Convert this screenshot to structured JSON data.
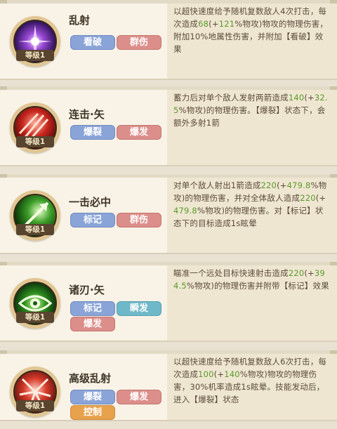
{
  "level_label": "等级1",
  "skills": [
    {
      "name": "乱射",
      "tags": [
        "看破",
        "群伤"
      ],
      "desc": [
        {
          "t": "以超快速度给予随机复数敌人4次打击，每次造成"
        },
        {
          "t": "68",
          "hl": true
        },
        {
          "t": "(+"
        },
        {
          "t": "121",
          "hl": true
        },
        {
          "t": "%物攻)物攻的物理伤害，附加10%地属性伤害，并附加【看破】效果"
        }
      ]
    },
    {
      "name": "连击·矢",
      "tags": [
        "爆裂",
        "爆发"
      ],
      "desc": [
        {
          "t": "蓄力后对单个敌人发射两箭造成"
        },
        {
          "t": "140",
          "hl": true
        },
        {
          "t": "(+"
        },
        {
          "t": "32.5",
          "hl": true
        },
        {
          "t": "%物攻)的物理伤害。【爆裂】状态下，会额外多射1箭"
        }
      ]
    },
    {
      "name": "一击必中",
      "tags": [
        "标记",
        "群伤"
      ],
      "desc": [
        {
          "t": "对单个敌人射出1箭造成"
        },
        {
          "t": "220",
          "hl": true
        },
        {
          "t": "(+"
        },
        {
          "t": "479.8",
          "hl": true
        },
        {
          "t": "%物攻)的物理伤害，并对全体敌人造成"
        },
        {
          "t": "220",
          "hl": true
        },
        {
          "t": "(+"
        },
        {
          "t": "479.8",
          "hl": true
        },
        {
          "t": "%物攻)的物理伤害。对【标记】状态下的目标造成1s眩晕"
        }
      ]
    },
    {
      "name": "诸刃·矢",
      "tags": [
        "标记",
        "瞬发",
        "爆发"
      ],
      "desc": [
        {
          "t": "瞄准一个远处目标快速射击造成"
        },
        {
          "t": "220",
          "hl": true
        },
        {
          "t": "(+"
        },
        {
          "t": "394.5",
          "hl": true
        },
        {
          "t": "%物攻)的物理伤害并附带【标记】效果"
        }
      ]
    },
    {
      "name": "高级乱射",
      "tags": [
        "爆裂",
        "爆发",
        "控制"
      ],
      "desc": [
        {
          "t": "以超快速度给予随机复数敌人6次打击，每次造成"
        },
        {
          "t": "100",
          "hl": true
        },
        {
          "t": "(+"
        },
        {
          "t": "140",
          "hl": true
        },
        {
          "t": "%物攻)物攻的物理伤害，30%机率造成1s眩晕。技能发动后，进入【爆裂】状态"
        }
      ]
    }
  ]
}
